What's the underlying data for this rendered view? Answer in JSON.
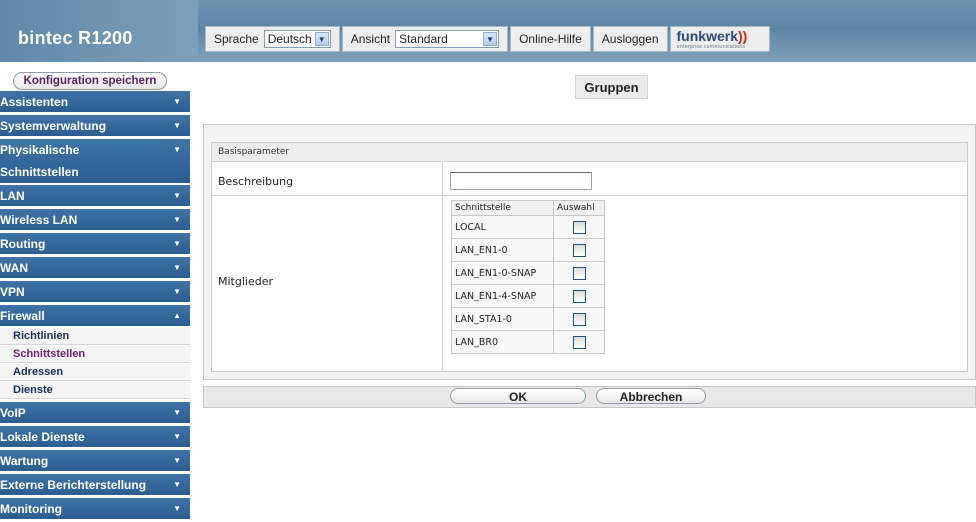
{
  "header": {
    "brand": "bintec R1200",
    "language_label": "Sprache",
    "language_value": "Deutsch",
    "view_label": "Ansicht",
    "view_value": "Standard",
    "help_label": "Online-Hilfe",
    "logout_label": "Ausloggen",
    "logo_text": "funkwerk",
    "logo_subtext": "enterprise communications"
  },
  "sidebar": {
    "save_label": "Konfiguration speichern",
    "items": [
      {
        "label": "Assistenten",
        "caret": "▼"
      },
      {
        "label": "Systemverwaltung",
        "caret": "▼"
      },
      {
        "label": "Physikalische Schnittstellen",
        "caret": "▼"
      },
      {
        "label": "LAN",
        "caret": "▼"
      },
      {
        "label": "Wireless LAN",
        "caret": "▼"
      },
      {
        "label": "Routing",
        "caret": "▼"
      },
      {
        "label": "WAN",
        "caret": "▼"
      },
      {
        "label": "VPN",
        "caret": "▼"
      },
      {
        "label": "Firewall",
        "caret": "▲"
      },
      {
        "label": "VoIP",
        "caret": "▼"
      },
      {
        "label": "Lokale Dienste",
        "caret": "▼"
      },
      {
        "label": "Wartung",
        "caret": "▼"
      },
      {
        "label": "Externe Berichterstellung",
        "caret": "▼"
      },
      {
        "label": "Monitoring",
        "caret": "▼"
      }
    ],
    "firewall_sub": [
      "Richtlinien",
      "Schnittstellen",
      "Adressen",
      "Dienste"
    ],
    "active_sub": "Schnittstellen"
  },
  "main": {
    "tab": "Gruppen",
    "section_header": "Basisparameter",
    "description_label": "Beschreibung",
    "description_value": "",
    "members_label": "Mitglieder",
    "members_table": {
      "col_interface": "Schnittstelle",
      "col_select": "Auswahl",
      "rows": [
        "LOCAL",
        "LAN_EN1-0",
        "LAN_EN1-0-SNAP",
        "LAN_EN1-4-SNAP",
        "LAN_STA1-0",
        "LAN_BR0"
      ]
    },
    "ok_label": "OK",
    "cancel_label": "Abbrechen"
  }
}
